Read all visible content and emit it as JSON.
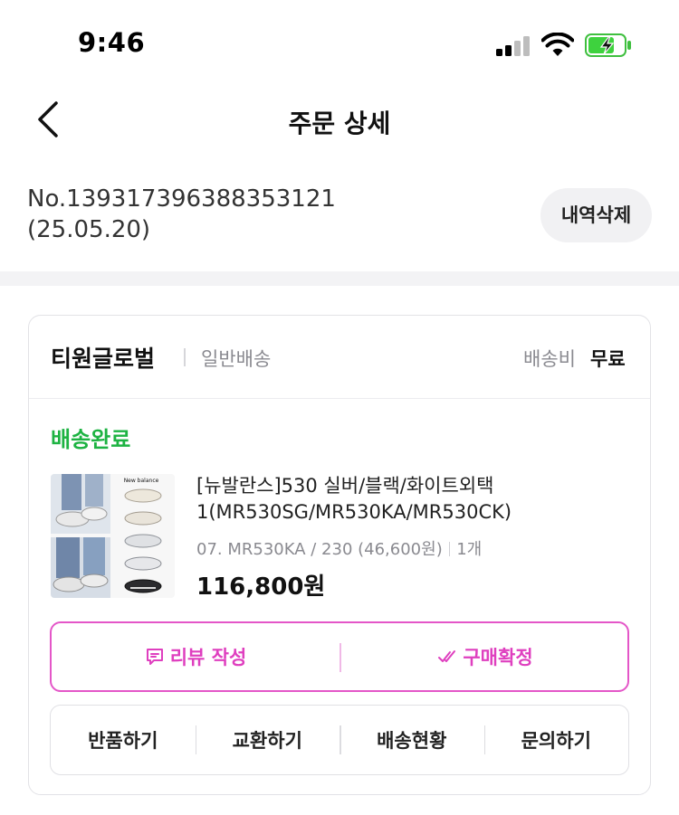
{
  "status_bar": {
    "time": "9:46"
  },
  "nav": {
    "title": "주문 상세"
  },
  "order": {
    "number": "No.1393173963883531​21",
    "date": "(25.05.20)",
    "delete_label": "내역삭제"
  },
  "card": {
    "seller": "티원글로벌",
    "shipping_type": "일반배송",
    "shipping_fee_label": "배송비",
    "shipping_fee_value": "무료",
    "status": "배송완료",
    "status_color": "#1db342",
    "product": {
      "name": "[뉴발란스]530 실버/블랙/화이트외택1(MR530SG/MR530KA/MR530CK)",
      "option": "07. MR530KA / 230  (46,600원)",
      "quantity": "1개",
      "price": "116,800원",
      "thumbnail_brand": "New balance"
    },
    "primary_actions": [
      {
        "label": "리뷰 작성",
        "icon": "review-icon"
      },
      {
        "label": "구매확정",
        "icon": "check-icon"
      }
    ],
    "accent_color": "#df3fbf",
    "secondary_actions": [
      {
        "label": "반품하기"
      },
      {
        "label": "교환하기"
      },
      {
        "label": "배송현황"
      },
      {
        "label": "문의하기"
      }
    ]
  }
}
